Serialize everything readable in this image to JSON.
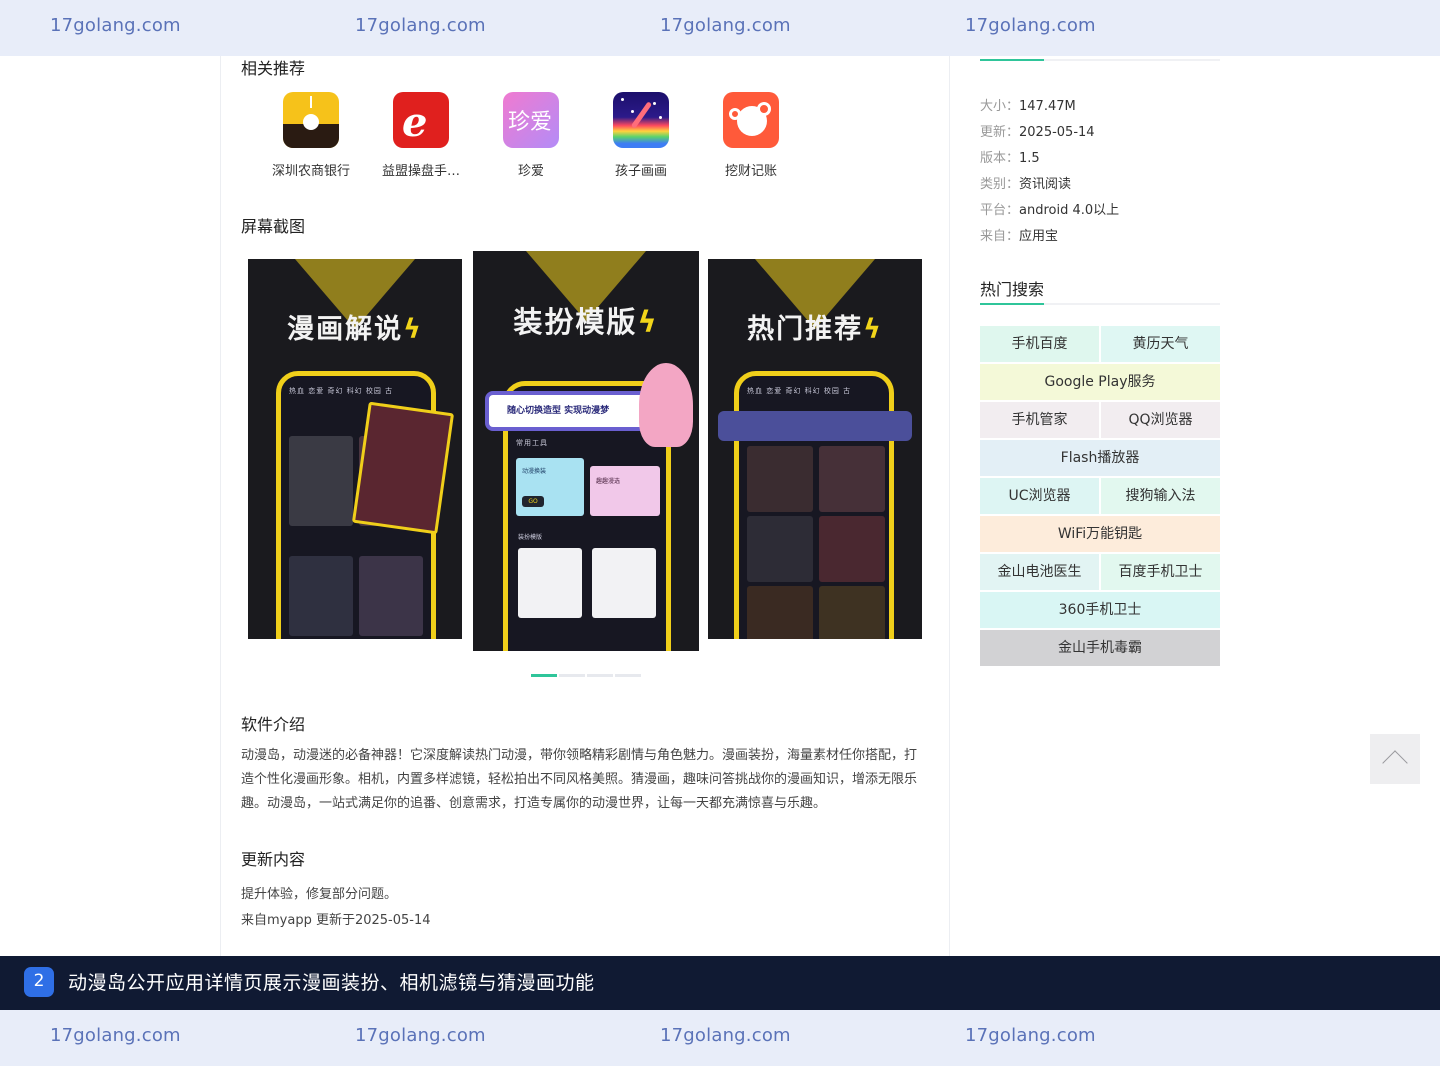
{
  "watermark": {
    "text": "17golang.com"
  },
  "related": {
    "title": "相关推荐",
    "apps": [
      {
        "name": "深圳农商银行",
        "icon": "shenzhen-bank-icon"
      },
      {
        "name": "益盟操盘手…",
        "icon": "yimeng-trader-icon"
      },
      {
        "name": "珍爱",
        "icon": "zhenai-icon",
        "glyph": "珍爱"
      },
      {
        "name": "孩子画画",
        "icon": "kids-drawing-icon"
      },
      {
        "name": "挖财记账",
        "icon": "wacai-ledger-icon"
      }
    ]
  },
  "screenshots": {
    "title": "屏幕截图",
    "slides": [
      {
        "headline": "漫画解说",
        "tabs": "热血  恋爱  奇幻  科幻  校园  古"
      },
      {
        "headline": "装扮模版",
        "tabs": "常用工具",
        "banner": "随心切换造型  实现动漫梦",
        "card1": "动漫换装",
        "card2": "趣趣漫选",
        "section": "装扮模版",
        "go": "GO"
      },
      {
        "headline": "热门推荐",
        "tabs": "热血  恋爱  奇幻  科幻  校园  古"
      }
    ],
    "pager": {
      "count": 4,
      "active": 0
    }
  },
  "intro": {
    "title": "软件介绍",
    "text": "动漫岛，动漫迷的必备神器！它深度解读热门动漫，带你领略精彩剧情与角色魅力。漫画装扮，海量素材任你搭配，打造个性化漫画形象。相机，内置多样滤镜，轻松拍出不同风格美照。猜漫画，趣味问答挑战你的漫画知识，增添无限乐趣。动漫岛，一站式满足你的追番、创意需求，打造专属你的动漫世界，让每一天都充满惊喜与乐趣。"
  },
  "update": {
    "title": "更新内容",
    "line1": "提升体验，修复部分问题。",
    "line2": "来自myapp 更新于2025-05-14"
  },
  "info": {
    "rows": [
      {
        "key": "大小：",
        "value": "147.47M"
      },
      {
        "key": "更新：",
        "value": "2025-05-14"
      },
      {
        "key": "版本：",
        "value": "1.5"
      },
      {
        "key": "类别：",
        "value": "资讯阅读"
      },
      {
        "key": "平台：",
        "value": "android 4.0以上"
      },
      {
        "key": "来自：",
        "value": "应用宝"
      }
    ]
  },
  "hot": {
    "title": "热门搜索",
    "rows": [
      [
        {
          "label": "手机百度",
          "color": "#dff7ee"
        },
        {
          "label": "黄历天气",
          "color": "#dff7f3"
        }
      ],
      [
        {
          "label": "Google Play服务",
          "color": "#f4f9d8"
        }
      ],
      [
        {
          "label": "手机管家",
          "color": "#f2edf0"
        },
        {
          "label": "QQ浏览器",
          "color": "#f2edf0"
        }
      ],
      [
        {
          "label": "Flash播放器",
          "color": "#e3eff6"
        }
      ],
      [
        {
          "label": "UC浏览器",
          "color": "#ddf5f3"
        },
        {
          "label": "搜狗输入法",
          "color": "#e2f8ef"
        }
      ],
      [
        {
          "label": "WiFi万能钥匙",
          "color": "#fdecdb"
        }
      ],
      [
        {
          "label": "金山电池医生",
          "color": "#e2f4f3"
        },
        {
          "label": "百度手机卫士",
          "color": "#e2f8ef"
        }
      ],
      [
        {
          "label": "360手机卫士",
          "color": "#d9f6f4"
        }
      ],
      [
        {
          "label": "金山手机毒霸",
          "color": "#d2d2d4"
        }
      ]
    ]
  },
  "caption": {
    "number": "2",
    "text": "动漫岛公开应用详情页展示漫画装扮、相机滤镜与猜漫画功能"
  }
}
